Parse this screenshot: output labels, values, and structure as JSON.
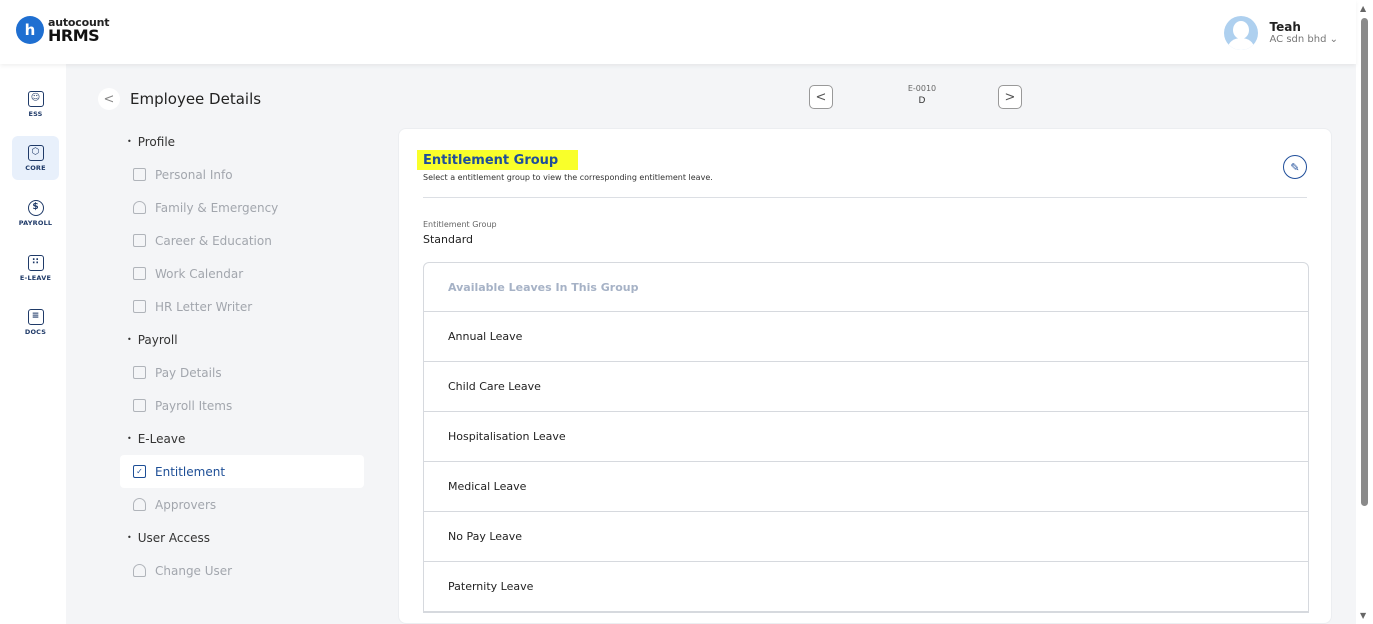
{
  "brand": {
    "badge": "h",
    "small": "autocount",
    "big": "HRMS",
    "color": "#1f6fd1"
  },
  "user": {
    "name": "Teah",
    "company": "AC sdn bhd ⌄"
  },
  "rail": [
    {
      "label": "ESS",
      "glyph": "☺",
      "icon": "ess-icon"
    },
    {
      "label": "CORE",
      "glyph": "⬡",
      "icon": "core-icon",
      "active": true
    },
    {
      "label": "PAYROLL",
      "glyph": "$",
      "icon": "payroll-icon"
    },
    {
      "label": "E-LEAVE",
      "glyph": "∷",
      "icon": "calendar-icon"
    },
    {
      "label": "DOCS",
      "glyph": "≡",
      "icon": "docs-icon"
    }
  ],
  "page": {
    "back": "<",
    "title": "Employee Details"
  },
  "employee_nav": {
    "prev": "<",
    "next": ">",
    "code": "E-0010",
    "name": "D"
  },
  "submenu": {
    "profile": "Profile",
    "personal_info": "Personal Info",
    "family": "Family & Emergency",
    "career": "Career & Education",
    "work_calendar": "Work Calendar",
    "hr_letter": "HR Letter Writer",
    "payroll": "Payroll",
    "pay_details": "Pay Details",
    "payroll_items": "Payroll Items",
    "eleave": "E-Leave",
    "entitlement": "Entitlement",
    "approvers": "Approvers",
    "user_access": "User Access",
    "change_user": "Change User"
  },
  "card": {
    "title": "Entitlement Group",
    "description": "Select a entitlement group to view the corresponding entitlement leave.",
    "edit_glyph": "✎",
    "field_label": "Entitlement Group",
    "field_value": "Standard",
    "table_header": "Available Leaves In This Group",
    "leaves": [
      "Annual Leave",
      "Child Care Leave",
      "Hospitalisation Leave",
      "Medical Leave",
      "No Pay Leave",
      "Paternity Leave"
    ]
  },
  "colors": {
    "accent": "#1f4e9a",
    "highlight": "#f9ff2a"
  }
}
